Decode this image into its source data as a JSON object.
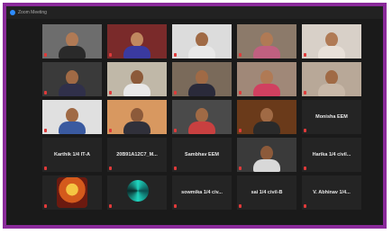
{
  "window": {
    "title": "Zoom Meeting"
  },
  "tiles": [
    {
      "type": "video",
      "bg": "#6d6d6d",
      "skin": "#b07a55",
      "shirt": "#2a2a2a",
      "label": ""
    },
    {
      "type": "video",
      "bg": "#7a2a2a",
      "skin": "#c08860",
      "shirt": "#3a3aa0",
      "label": ""
    },
    {
      "type": "video",
      "bg": "#dcdcdc",
      "skin": "#a06a45",
      "shirt": "#e8e8e8",
      "label": ""
    },
    {
      "type": "video",
      "bg": "#8c7a6a",
      "skin": "#b07a55",
      "shirt": "#c06080",
      "label": ""
    },
    {
      "type": "video",
      "bg": "#d8d0c8",
      "skin": "#b07a55",
      "shirt": "#e8e0d8",
      "label": ""
    },
    {
      "type": "video",
      "bg": "#3a3a3a",
      "skin": "#a06a45",
      "shirt": "#30304a",
      "label": "",
      "active": true
    },
    {
      "type": "video",
      "bg": "#c0b8a8",
      "skin": "#8c5a3a",
      "shirt": "#e8e8e8",
      "label": ""
    },
    {
      "type": "video",
      "bg": "#7a6a5a",
      "skin": "#a06a45",
      "shirt": "#2a2a3a",
      "label": ""
    },
    {
      "type": "video",
      "bg": "#a08878",
      "skin": "#b07a55",
      "shirt": "#d04060",
      "label": ""
    },
    {
      "type": "video",
      "bg": "#b8a898",
      "skin": "#a06a45",
      "shirt": "#c8b8a8",
      "label": ""
    },
    {
      "type": "video",
      "bg": "#e0e0e0",
      "skin": "#a06a45",
      "shirt": "#3a5aa0",
      "label": ""
    },
    {
      "type": "video",
      "bg": "#d89860",
      "skin": "#8c5a3a",
      "shirt": "#30303a",
      "label": ""
    },
    {
      "type": "video",
      "bg": "#4a4a4a",
      "skin": "#a06a45",
      "shirt": "#c84040",
      "label": ""
    },
    {
      "type": "video",
      "bg": "#6a3a1a",
      "skin": "#a06a45",
      "shirt": "#2a2a2a",
      "label": ""
    },
    {
      "type": "name",
      "name": "Monisha EEM"
    },
    {
      "type": "name",
      "name": "Karthik 1/4 IT-A"
    },
    {
      "type": "name",
      "name": "20B91A12C7_M..."
    },
    {
      "type": "name",
      "name": "Sambhav EEM"
    },
    {
      "type": "video",
      "bg": "#3a3a3a",
      "skin": "#8c5a3a",
      "shirt": "#d8d8d8",
      "label": ""
    },
    {
      "type": "name",
      "name": "Harika 1/4 civil..."
    },
    {
      "type": "image",
      "art": "shrine",
      "label": ""
    },
    {
      "type": "image",
      "art": "swirl",
      "label": ""
    },
    {
      "type": "name",
      "name": "sowmika 1/4 civ..."
    },
    {
      "type": "name",
      "name": "sai 1/4 civil-B"
    },
    {
      "type": "name",
      "name": "V. Abhinav 1/4..."
    }
  ]
}
